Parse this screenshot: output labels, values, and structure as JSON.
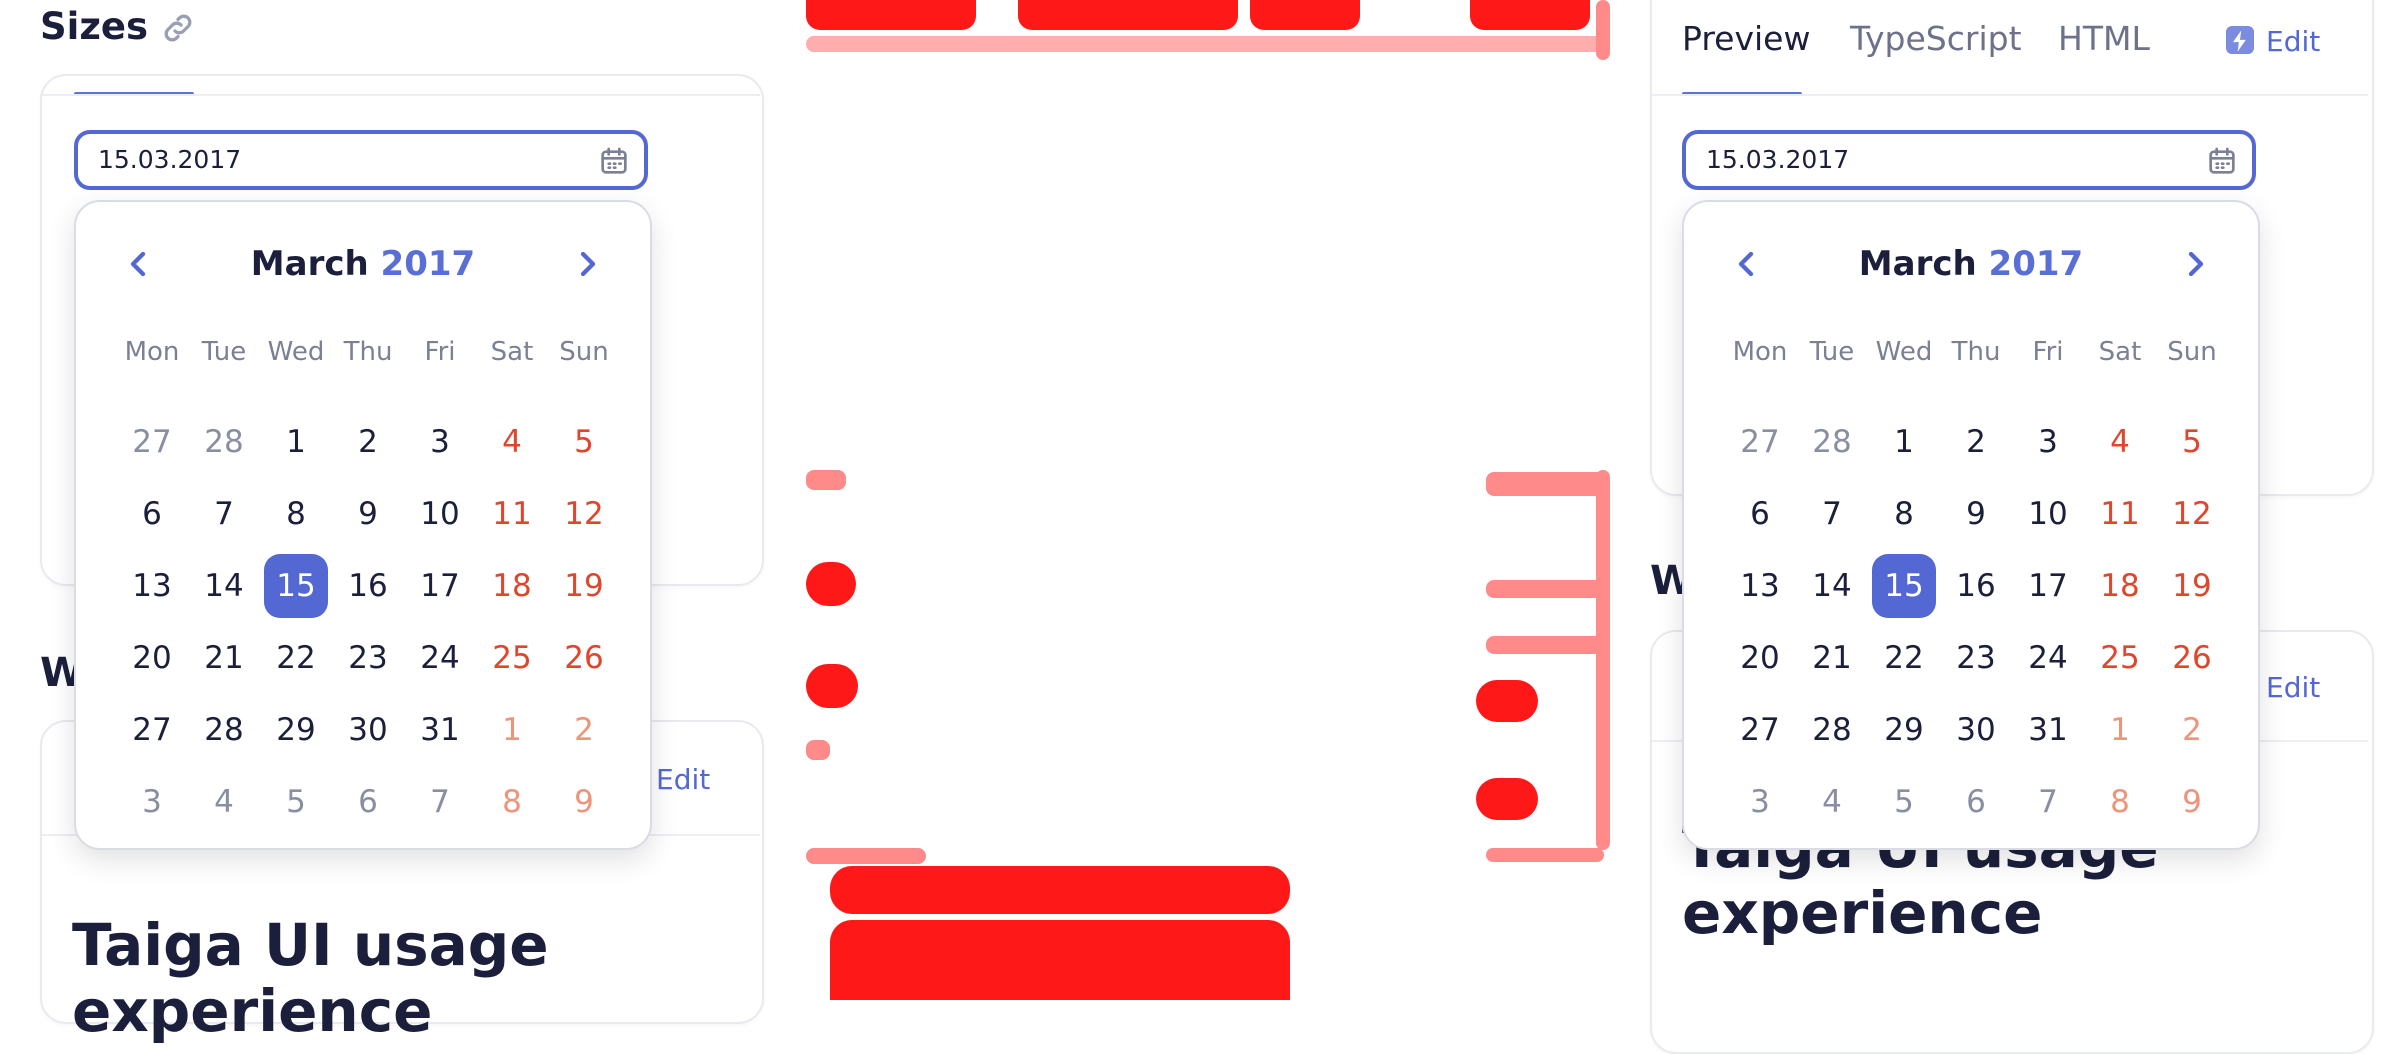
{
  "sizes_heading": "Sizes",
  "left": {
    "date_value": "15.03.2017",
    "section_heading_partial": "W",
    "edit_label": "Edit",
    "article_heading_line1": "Taiga UI usage",
    "article_heading_line2": "experience"
  },
  "right": {
    "tabs": [
      "Preview",
      "TypeScript",
      "HTML"
    ],
    "edit_label": "Edit",
    "date_value": "15.03.2017",
    "section_heading_partial": "W",
    "edit_label_2": "Edit",
    "article_heading_line1": "Taiga UI usage",
    "article_heading_line2": "experience"
  },
  "calendar": {
    "month": "March",
    "year": "2017",
    "weekdays": [
      "Mon",
      "Tue",
      "Wed",
      "Thu",
      "Fri",
      "Sat",
      "Sun"
    ],
    "weeks": [
      [
        "27",
        "28",
        "1",
        "2",
        "3",
        "4",
        "5"
      ],
      [
        "6",
        "7",
        "8",
        "9",
        "10",
        "11",
        "12"
      ],
      [
        "13",
        "14",
        "15",
        "16",
        "17",
        "18",
        "19"
      ],
      [
        "20",
        "21",
        "22",
        "23",
        "24",
        "25",
        "26"
      ],
      [
        "27",
        "28",
        "29",
        "30",
        "31",
        "1",
        "2"
      ],
      [
        "3",
        "4",
        "5",
        "6",
        "7",
        "8",
        "9"
      ]
    ],
    "outside_rows": {
      "0": [
        0,
        1
      ],
      "4": [
        5,
        6
      ],
      "5": [
        0,
        1,
        2,
        3,
        4,
        5,
        6
      ]
    },
    "selected_day": "15"
  },
  "icons": {
    "link": "link-icon",
    "calendar": "calendar-icon",
    "prev": "chevron-left-icon",
    "next": "chevron-right-icon",
    "edit": "lightning-icon"
  },
  "colors": {
    "accent": "#5468d4",
    "weekend": "#e0462b",
    "text": "#1b1f3b"
  }
}
